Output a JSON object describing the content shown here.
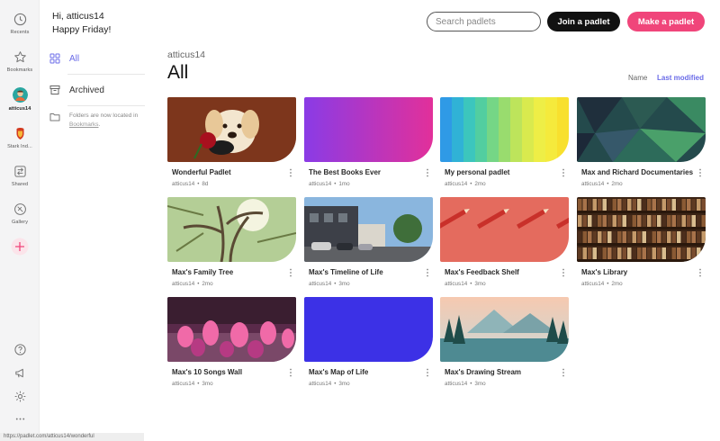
{
  "rail": {
    "recents": {
      "label": "Recents",
      "icon": "clock-icon"
    },
    "bookmarks": {
      "label": "Bookmarks",
      "icon": "star-icon"
    },
    "user": {
      "label": "atticus14",
      "icon": "user-avatar"
    },
    "workspace": {
      "label": "Stark Ind...",
      "icon": "workspace-avatar"
    },
    "shared": {
      "label": "Shared",
      "icon": "shared-icon"
    },
    "gallery": {
      "label": "Gallery",
      "icon": "gallery-icon"
    },
    "add": {
      "icon": "plus-icon",
      "color": "#f0457a"
    },
    "help": {
      "icon": "help-icon"
    },
    "announce": {
      "icon": "megaphone-icon"
    },
    "settings": {
      "icon": "gear-icon"
    },
    "more": {
      "icon": "more-icon"
    }
  },
  "header": {
    "greeting": "Hi, atticus14",
    "subgreeting": "Happy Friday!",
    "search_placeholder": "Search padlets",
    "join_label": "Join a padlet",
    "make_label": "Make a padlet"
  },
  "sidebar": {
    "all": "All",
    "archived": "Archived",
    "note_text": "Folders are now located in",
    "note_link": "Bookmarks",
    "note_end": "."
  },
  "main": {
    "user": "atticus14",
    "title": "All",
    "sort_name": "Name",
    "sort_modified": "Last modified"
  },
  "padlets": [
    {
      "title": "Wonderful Padlet",
      "owner": "atticus14",
      "age": "8d",
      "thumb": "puppy"
    },
    {
      "title": "The Best Books Ever",
      "owner": "atticus14",
      "age": "1mo",
      "thumb": "purple-gradient"
    },
    {
      "title": "My personal padlet",
      "owner": "atticus14",
      "age": "2mo",
      "thumb": "rainbow-stripes"
    },
    {
      "title": "Max and Richard Documentaries",
      "owner": "atticus14",
      "age": "2mo",
      "thumb": "green-polygons"
    },
    {
      "title": "Max's Family Tree",
      "owner": "atticus14",
      "age": "2mo",
      "thumb": "tree"
    },
    {
      "title": "Max's Timeline of Life",
      "owner": "atticus14",
      "age": "3mo",
      "thumb": "street"
    },
    {
      "title": "Max's Feedback Shelf",
      "owner": "atticus14",
      "age": "3mo",
      "thumb": "pencils"
    },
    {
      "title": "Max's Library",
      "owner": "atticus14",
      "age": "2mo",
      "thumb": "bookshelf"
    },
    {
      "title": "Max's 10 Songs Wall",
      "owner": "atticus14",
      "age": "3mo",
      "thumb": "dancers"
    },
    {
      "title": "Max's Map of Life",
      "owner": "atticus14",
      "age": "3mo",
      "thumb": "blue-solid"
    },
    {
      "title": "Max's Drawing Stream",
      "owner": "atticus14",
      "age": "3mo",
      "thumb": "lake"
    }
  ],
  "meta_separator": "•",
  "status_url": "https://padlet.com/atticus14/wonderful"
}
